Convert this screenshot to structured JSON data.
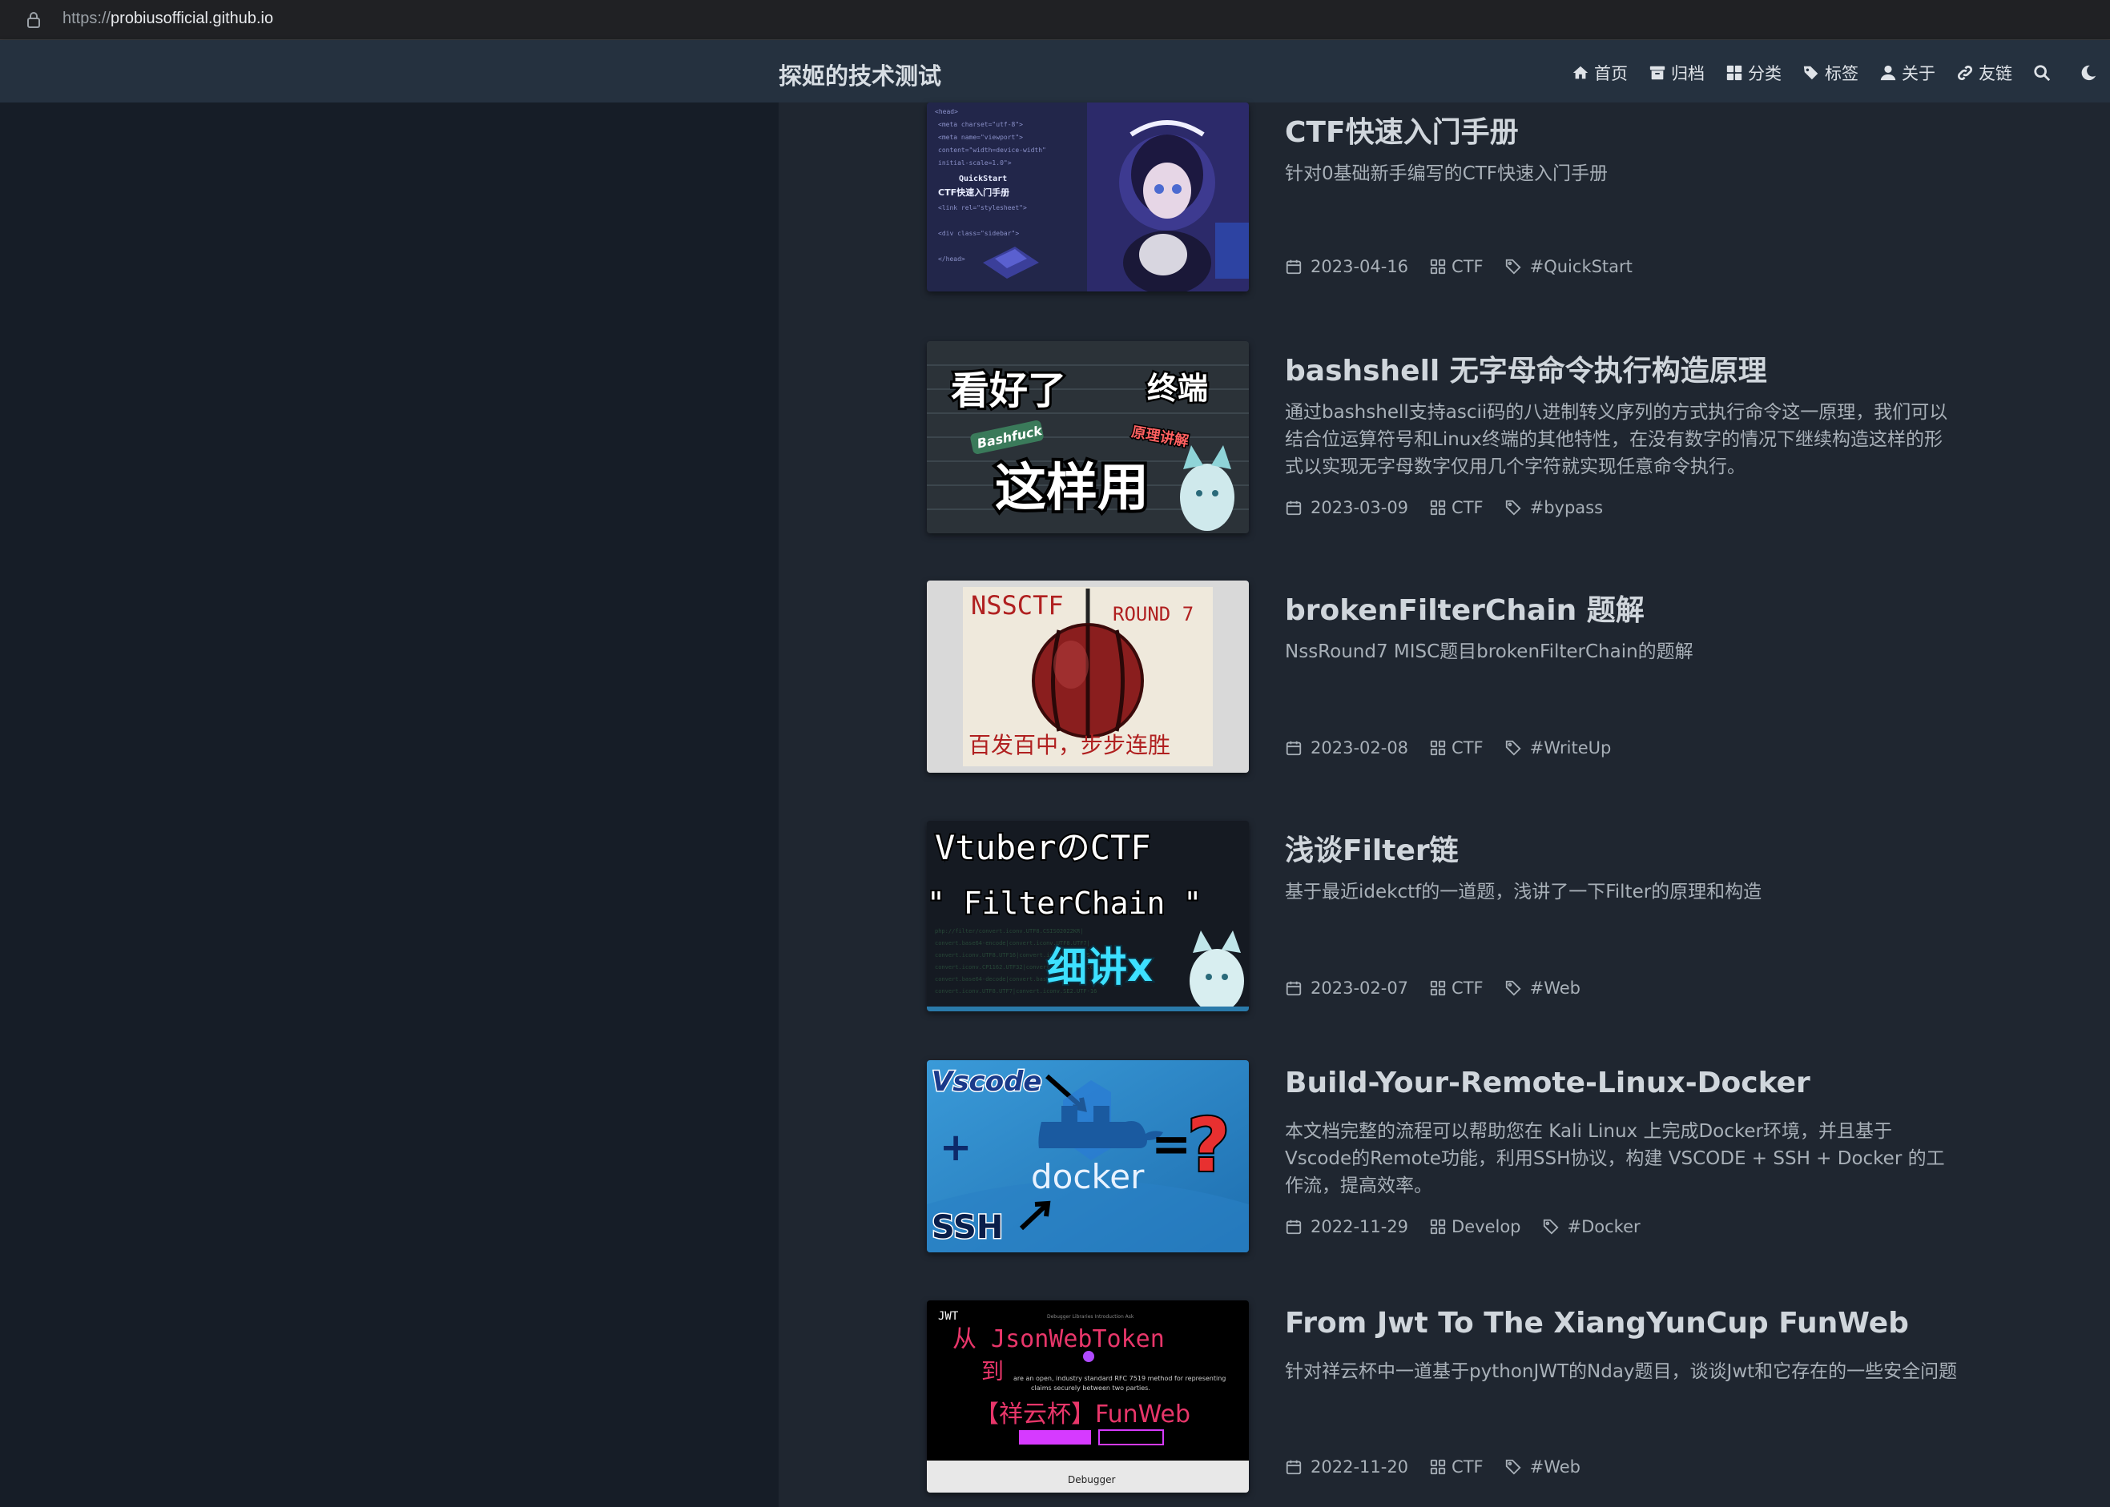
{
  "browser": {
    "url_scheme": "https://",
    "url_host": "probiusofficial.github.io"
  },
  "header": {
    "site_title": "探姬的技术测试",
    "nav": [
      {
        "label": "首页",
        "icon": "home-icon"
      },
      {
        "label": "归档",
        "icon": "archive-icon"
      },
      {
        "label": "分类",
        "icon": "grid-icon"
      },
      {
        "label": "标签",
        "icon": "tags-icon"
      },
      {
        "label": "关于",
        "icon": "user-icon"
      },
      {
        "label": "友链",
        "icon": "link-icon"
      }
    ],
    "search_icon": "search-icon",
    "theme_icon": "moon-icon"
  },
  "posts": [
    {
      "title": "CTF快速入门手册",
      "description": "针对0基础新手编写的CTF快速入门手册",
      "date": "2023-04-16",
      "category": "CTF",
      "tag": "#QuickStart",
      "thumb": {
        "text1": "QuickStart",
        "text2": "CTF快速入门手册"
      }
    },
    {
      "title": "bashshell 无字母命令执行构造原理",
      "description": "通过bashshell支持ascii码的八进制转义序列的方式执行命令这一原理，我们可以结合位运算符号和Linux终端的其他特性，在没有数字的情况下继续构造这样的形式以实现无字母数字仅用几个字符就实现任意命令执行。",
      "date": "2023-03-09",
      "category": "CTF",
      "tag": "#bypass",
      "thumb": {
        "text1": "看好了",
        "text2": "终端",
        "text3": "Bashfuck",
        "text4": "这样用",
        "text5": "原理讲解"
      }
    },
    {
      "title": "brokenFilterChain 题解",
      "description": "NssRound7 MISC题目brokenFilterChain的题解",
      "date": "2023-02-08",
      "category": "CTF",
      "tag": "#WriteUp",
      "thumb": {
        "text1": "NSSCTF",
        "text2": "ROUND 7",
        "text3": "百发百中，步步连胜"
      }
    },
    {
      "title": "浅谈Filter链",
      "description": "基于最近idekctf的一道题，浅讲了一下Filter的原理和构造",
      "date": "2023-02-07",
      "category": "CTF",
      "tag": "#Web",
      "thumb": {
        "text1": "VtuberのCTF",
        "text2": "\" FilterChain \"",
        "text3": "细讲x"
      }
    },
    {
      "title": "Build-Your-Remote-Linux-Docker",
      "description": "本文档完整的流程可以帮助您在 Kali Linux 上完成Docker环境，并且基于Vscode的Remote功能，利用SSH协议，构建 VSCODE + SSH + Docker 的工作流，提高效率。",
      "date": "2022-11-29",
      "category": "Develop",
      "tag": "#Docker",
      "thumb": {
        "text1": "Vscode",
        "text2": "SSH",
        "text3": "docker",
        "text4": "+",
        "text5": "=",
        "text6": "?"
      }
    },
    {
      "title": "From Jwt To The XiangYunCup FunWeb",
      "description": "针对祥云杯中一道基于pythonJWT的Nday题目，谈谈Jwt和它存在的一些安全问题",
      "date": "2022-11-20",
      "category": "CTF",
      "tag": "#Web",
      "thumb": {
        "text1": "从 JsonWebToken",
        "text2": "到",
        "text3": "【祥云杯】FunWeb",
        "text4": "Debugger",
        "text5": "JWT"
      }
    }
  ],
  "colors": {
    "header_bg": "#25313f",
    "sidebar_bg": "#161d27",
    "main_bg": "#1f2630"
  }
}
